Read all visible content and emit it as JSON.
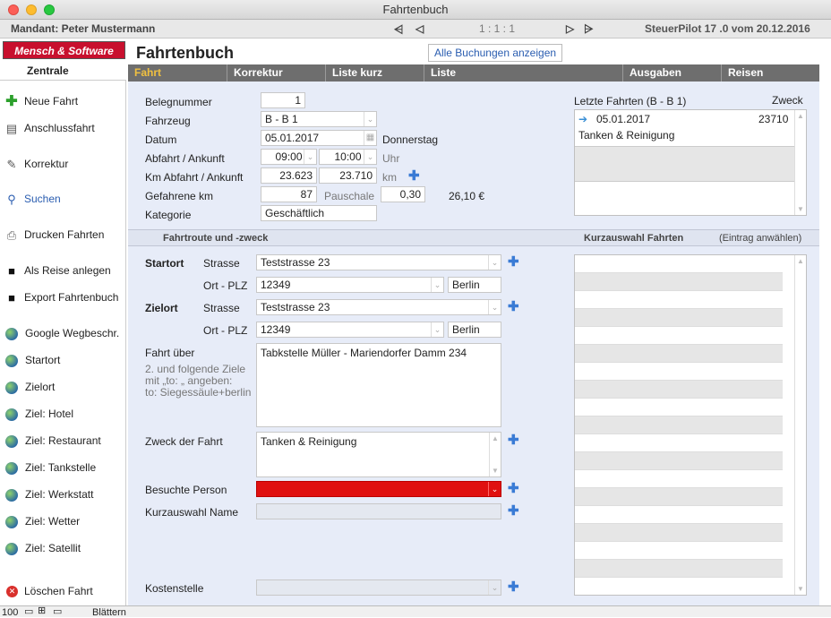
{
  "window": {
    "title": "Fahrtenbuch"
  },
  "infobar": {
    "mandant": "Mandant: Peter Mustermann",
    "page": "1 : 1 : 1",
    "version": "SteuerPilot 17 .0 vom 20.12.2016"
  },
  "logo": {
    "text": "Mensch & Software",
    "subtitle": "Zentrale"
  },
  "header": {
    "title": "Fahrtenbuch",
    "all_bookings": "Alle Buchungen anzeigen"
  },
  "tabs": [
    "Fahrt",
    "Korrektur",
    "Liste kurz",
    "Liste",
    "Ausgaben",
    "Reisen"
  ],
  "sidebar": {
    "items": [
      "Neue Fahrt",
      "Anschlussfahrt",
      "Korrektur",
      "Suchen",
      "Drucken Fahrten",
      "Als Reise anlegen",
      "Export Fahrtenbuch",
      "Google Wegbeschr.",
      "Startort",
      "Zielort",
      "Ziel: Hotel",
      "Ziel: Restaurant",
      "Ziel: Tankstelle",
      "Ziel: Werkstatt",
      "Ziel: Wetter",
      "Ziel: Satellit",
      "Löschen Fahrt"
    ]
  },
  "form": {
    "belegnummer_label": "Belegnummer",
    "belegnummer": "1",
    "fahrzeug_label": "Fahrzeug",
    "fahrzeug": "B - B 1",
    "datum_label": "Datum",
    "datum": "05.01.2017",
    "wochentag": "Donnerstag",
    "abfahrt_label": "Abfahrt / Ankunft",
    "abfahrt": "09:00",
    "ankunft": "10:00",
    "uhr": "Uhr",
    "km_label": "Km Abfahrt / Ankunft",
    "km_abfahrt": "23.623",
    "km_ankunft": "23.710",
    "km_unit": "km",
    "gefahrene_label": "Gefahrene km",
    "gefahrene": "87",
    "pauschale_label": "Pauschale",
    "pauschale": "0,30",
    "betrag": "26,10 €",
    "kategorie_label": "Kategorie",
    "kategorie": "Geschäftlich"
  },
  "letzte": {
    "title": "Letzte Fahrten (B - B 1)",
    "zweck_label": "Zweck",
    "date": "05.01.2017",
    "km": "23710",
    "zweck": "Tanken & Reinigung"
  },
  "route": {
    "section": "Fahrtroute und -zweck",
    "kurzauswahl": "Kurzauswahl Fahrten",
    "eintrag": "(Eintrag anwählen)",
    "startort_label": "Startort",
    "strasse_label": "Strasse",
    "ortplz_label": "Ort - PLZ",
    "start_strasse": "Teststrasse 23",
    "start_plz": "12349",
    "start_ort": "Berlin",
    "zielort_label": "Zielort",
    "ziel_strasse": "Teststrasse 23",
    "ziel_plz": "12349",
    "ziel_ort": "Berlin",
    "ueber_label": "Fahrt über",
    "ueber_hint": "2. und folgende Ziele\nmit „to: „ angeben:\nto: Siegessäule+berlin",
    "ueber": "Tabkstelle Müller - Mariendorfer Damm 234",
    "zweck_label": "Zweck der Fahrt",
    "zweck": "Tanken & Reinigung",
    "person_label": "Besuchte Person",
    "kurzname_label": "Kurzauswahl Name",
    "kosten_label": "Kostenstelle"
  },
  "statusbar": {
    "zoom": "100",
    "mode": "Blättern"
  }
}
